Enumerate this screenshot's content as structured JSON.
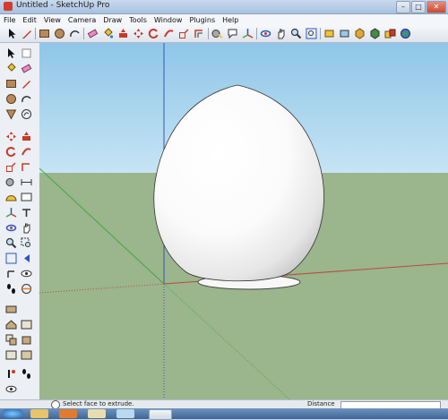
{
  "window": {
    "title": "Untitled - SketchUp Pro"
  },
  "controls": {
    "minimize": "–",
    "maximize": "□",
    "close": "✕"
  },
  "menu": [
    "File",
    "Edit",
    "View",
    "Camera",
    "Draw",
    "Tools",
    "Window",
    "Plugins",
    "Help"
  ],
  "toolbar_icons": [
    "select-arrow-icon",
    "pencil-icon",
    "rectangle-icon",
    "circle-icon",
    "arc-icon",
    "eraser-icon",
    "paint-bucket-icon",
    "push-pull-icon",
    "move-icon",
    "rotate-icon",
    "follow-me-icon",
    "scale-icon",
    "offset-icon",
    "tape-measure-icon",
    "text-icon",
    "axes-icon",
    "orbit-icon",
    "pan-icon",
    "zoom-icon",
    "zoom-extents-icon",
    "previous-view-icon",
    "next-view-icon",
    "get-models-icon",
    "share-model-icon",
    "components-icon",
    "add-location-icon"
  ],
  "left_toolbar_icons": [
    "select-icon",
    "component-icon",
    "paint-bucket-icon",
    "eraser-icon",
    "rectangle-icon",
    "line-icon",
    "circle-icon",
    "arc-icon",
    "polygon-icon",
    "freehand-icon",
    "move-icon",
    "push-pull-icon",
    "rotate-icon",
    "follow-me-icon",
    "scale-icon",
    "offset-icon",
    "tape-measure-icon",
    "dimension-icon",
    "protractor-icon",
    "text-icon",
    "axes-icon",
    "3d-text-icon",
    "orbit-icon",
    "pan-icon",
    "zoom-icon",
    "zoom-window-icon",
    "zoom-extents-icon",
    "previous-icon",
    "position-camera-icon",
    "look-around-icon",
    "walk-icon",
    "section-plane-icon",
    "walls-icon",
    "roof-icon",
    "plan-icon",
    "elevation-icon",
    "iso-icon",
    "shadow-icon",
    "footprint-icon",
    "eye-icon"
  ],
  "status": {
    "hint": "Select face to extrude.",
    "measurements_label": "Distance"
  },
  "colors": {
    "sky_top": "#8fc6e8",
    "ground": "#9bb58d",
    "blue_axis": "#3358b6",
    "green_axis": "#3fa840",
    "red_axis": "#b94a3e"
  }
}
